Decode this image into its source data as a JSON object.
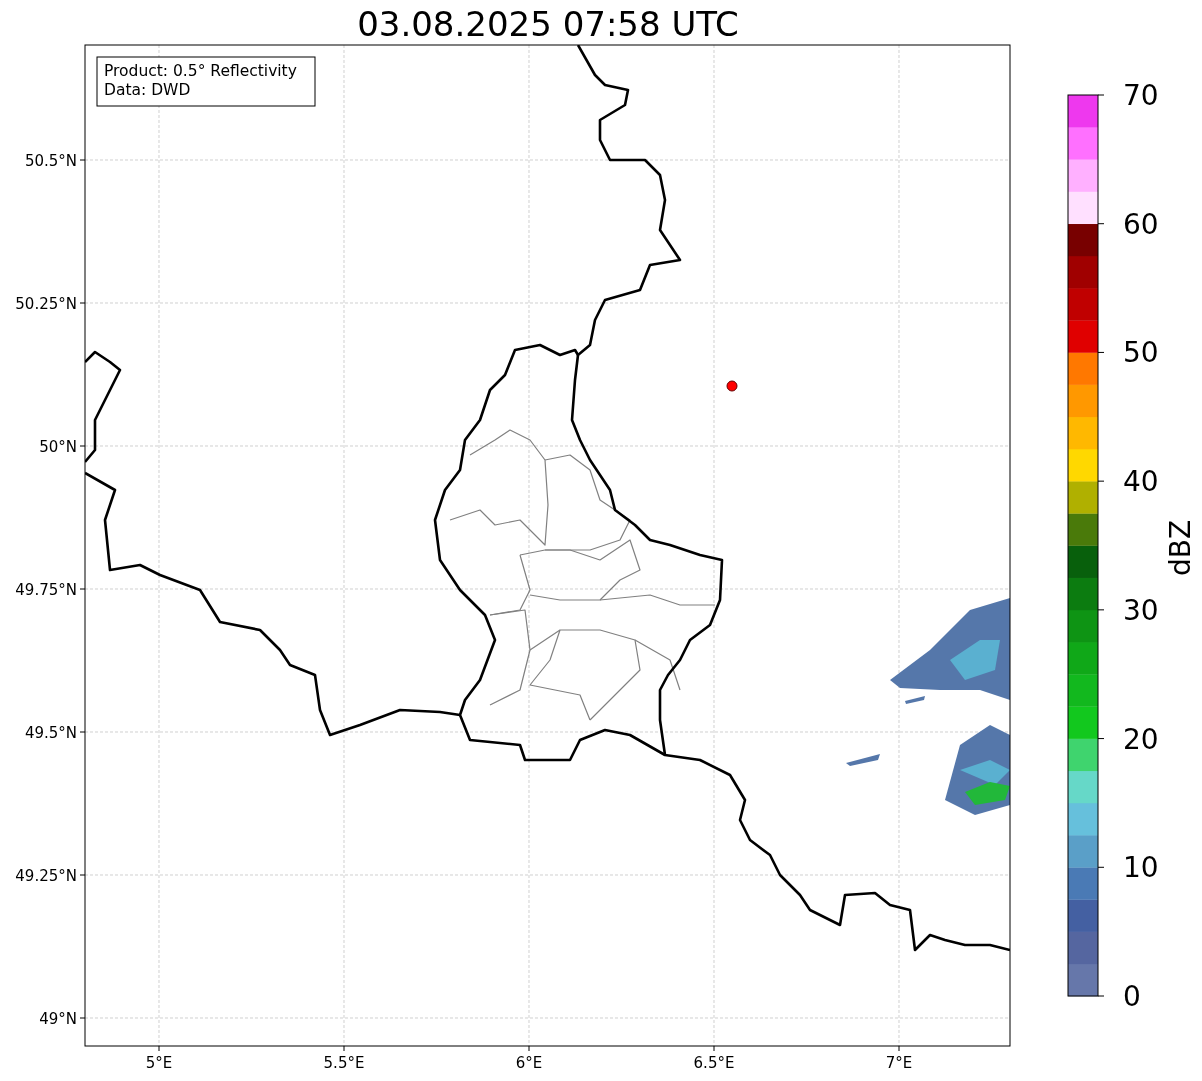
{
  "title": "03.08.2025 07:58 UTC",
  "legend": [
    "Product: 0.5° Reflectivity",
    "Data: DWD"
  ],
  "map": {
    "yticks": [
      "50.5°N",
      "50.25°N",
      "50°N",
      "49.75°N",
      "49.5°N",
      "49.25°N",
      "49°N"
    ],
    "xticks": [
      "5°E",
      "5.5°E",
      "6°E",
      "6.5°E",
      "7°E"
    ]
  },
  "colorbar": {
    "label": "dBZ",
    "ticks": [
      "70",
      "60",
      "50",
      "40",
      "30",
      "20",
      "10",
      "0"
    ],
    "bands": [
      {
        "color": "#6677aa"
      },
      {
        "color": "#5566a0"
      },
      {
        "color": "#4460a2"
      },
      {
        "color": "#4a7ab5"
      },
      {
        "color": "#5a9fc8"
      },
      {
        "color": "#66c0dc"
      },
      {
        "color": "#66d8c8"
      },
      {
        "color": "#3fd46e"
      },
      {
        "color": "#12c81e"
      },
      {
        "color": "#12b81e"
      },
      {
        "color": "#10a818"
      },
      {
        "color": "#0e9414"
      },
      {
        "color": "#0c7c10"
      },
      {
        "color": "#08600c"
      },
      {
        "color": "#4a7a0a"
      },
      {
        "color": "#b0b000"
      },
      {
        "color": "#ffd800"
      },
      {
        "color": "#ffb800"
      },
      {
        "color": "#ff9800"
      },
      {
        "color": "#ff7800"
      },
      {
        "color": "#e00000"
      },
      {
        "color": "#c00000"
      },
      {
        "color": "#a00000"
      },
      {
        "color": "#780000"
      },
      {
        "color": "#ffe0ff"
      },
      {
        "color": "#ffb0ff"
      },
      {
        "color": "#ff70ff"
      },
      {
        "color": "#ee38ee"
      }
    ]
  }
}
